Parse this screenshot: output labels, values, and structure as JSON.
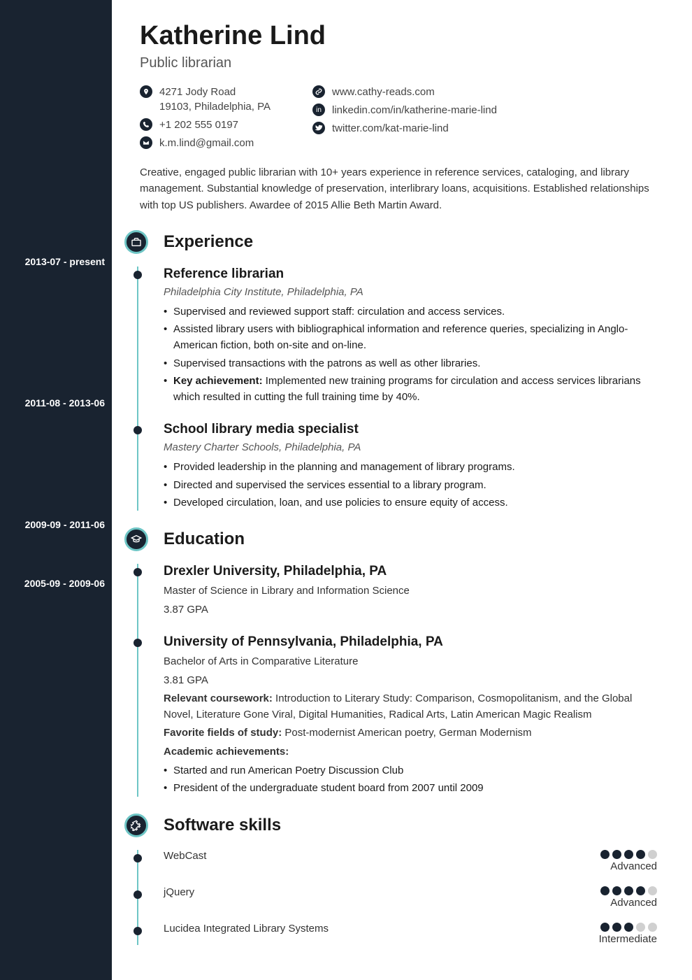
{
  "name": "Katherine Lind",
  "role": "Public librarian",
  "contact": {
    "address1": "4271 Jody Road",
    "address2": "19103, Philadelphia, PA",
    "phone": "+1 202 555 0197",
    "email": "k.m.lind@gmail.com",
    "web": "www.cathy-reads.com",
    "linkedin": "linkedin.com/in/katherine-marie-lind",
    "twitter": "twitter.com/kat-marie-lind"
  },
  "summary": "Creative, engaged public librarian with 10+ years experience in reference services, cataloging, and library management. Substantial knowledge of preservation, interlibrary loans, acquisitions. Established relationships with top US publishers. Awardee of 2015 Allie Beth Martin Award.",
  "sections": {
    "experience": "Experience",
    "education": "Education",
    "software": "Software skills"
  },
  "experience": [
    {
      "date": "2013-07 - present",
      "title": "Reference librarian",
      "org": "Philadelphia City Institute, Philadelphia, PA",
      "bullets": [
        "Supervised and reviewed support staff: circulation and access services.",
        "Assisted library users with bibliographical information and reference queries, specializing in Anglo-American fiction, both on-site and on-line.",
        "Supervised transactions with the patrons as well as other libraries."
      ],
      "key_label": "Key achievement:",
      "key_text": " Implemented new training programs for circulation and access services librarians which resulted in cutting the full training time by 40%."
    },
    {
      "date": "2011-08 - 2013-06",
      "title": "School library media specialist",
      "org": "Mastery Charter Schools, Philadelphia, PA",
      "bullets": [
        "Provided leadership in the planning and management of library programs.",
        "Directed and supervised the services essential to a library program.",
        "Developed circulation, loan, and use policies to ensure equity of access."
      ]
    }
  ],
  "education": [
    {
      "date": "2009-09 - 2011-06",
      "title": "Drexler University, Philadelphia, PA",
      "degree": "Master of Science in Library and Information Science",
      "gpa": "3.87 GPA"
    },
    {
      "date": "2005-09 - 2009-06",
      "title": "University of Pennsylvania, Philadelphia, PA",
      "degree": "Bachelor of Arts in Comparative Literature",
      "gpa": "3.81 GPA",
      "coursework_label": "Relevant coursework:",
      "coursework": " Introduction to Literary Study: Comparison, Cosmopolitanism, and the Global Novel, Literature Gone Viral, Digital Humanities, Radical Arts, Latin American Magic Realism",
      "fav_label": "Favorite fields of study:",
      "fav": " Post-modernist American poetry, German Modernism",
      "ach_label": "Academic achievements:",
      "achievements": [
        "Started and run American Poetry Discussion Club",
        "President of the undergraduate student board from 2007 until 2009"
      ]
    }
  ],
  "skills": [
    {
      "name": "WebCast",
      "level": 4,
      "label": "Advanced"
    },
    {
      "name": "jQuery",
      "level": 4,
      "label": "Advanced"
    },
    {
      "name": "Lucidea Integrated Library Systems",
      "level": 3,
      "label": "Intermediate"
    }
  ]
}
